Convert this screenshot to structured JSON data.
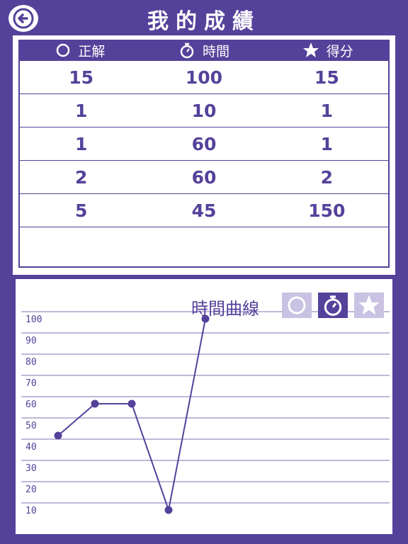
{
  "header": {
    "title": "我的成績",
    "back_icon": "back-arrow-icon"
  },
  "table": {
    "columns": [
      {
        "label": "正解",
        "icon": "circle-icon"
      },
      {
        "label": "時間",
        "icon": "stopwatch-icon"
      },
      {
        "label": "得分",
        "icon": "star-icon"
      }
    ],
    "rows": [
      [
        "15",
        "100",
        "15"
      ],
      [
        "1",
        "10",
        "1"
      ],
      [
        "1",
        "60",
        "1"
      ],
      [
        "2",
        "60",
        "2"
      ],
      [
        "5",
        "45",
        "150"
      ]
    ]
  },
  "chart_panel": {
    "title": "時間曲線",
    "modes": [
      {
        "icon": "circle-icon",
        "active": false
      },
      {
        "icon": "stopwatch-icon",
        "active": true
      },
      {
        "icon": "star-icon",
        "active": false
      }
    ]
  },
  "chart_data": {
    "type": "line",
    "x": [
      1,
      2,
      3,
      4,
      5
    ],
    "values": [
      45,
      60,
      60,
      10,
      100
    ],
    "ylim": [
      0,
      100
    ],
    "yticks": [
      10,
      20,
      30,
      40,
      50,
      60,
      70,
      80,
      90,
      100
    ],
    "grid": true,
    "color": "#54429a"
  },
  "colors": {
    "primary": "#54429a",
    "inactive": "#c9c2e2",
    "background": "#ffffff"
  }
}
